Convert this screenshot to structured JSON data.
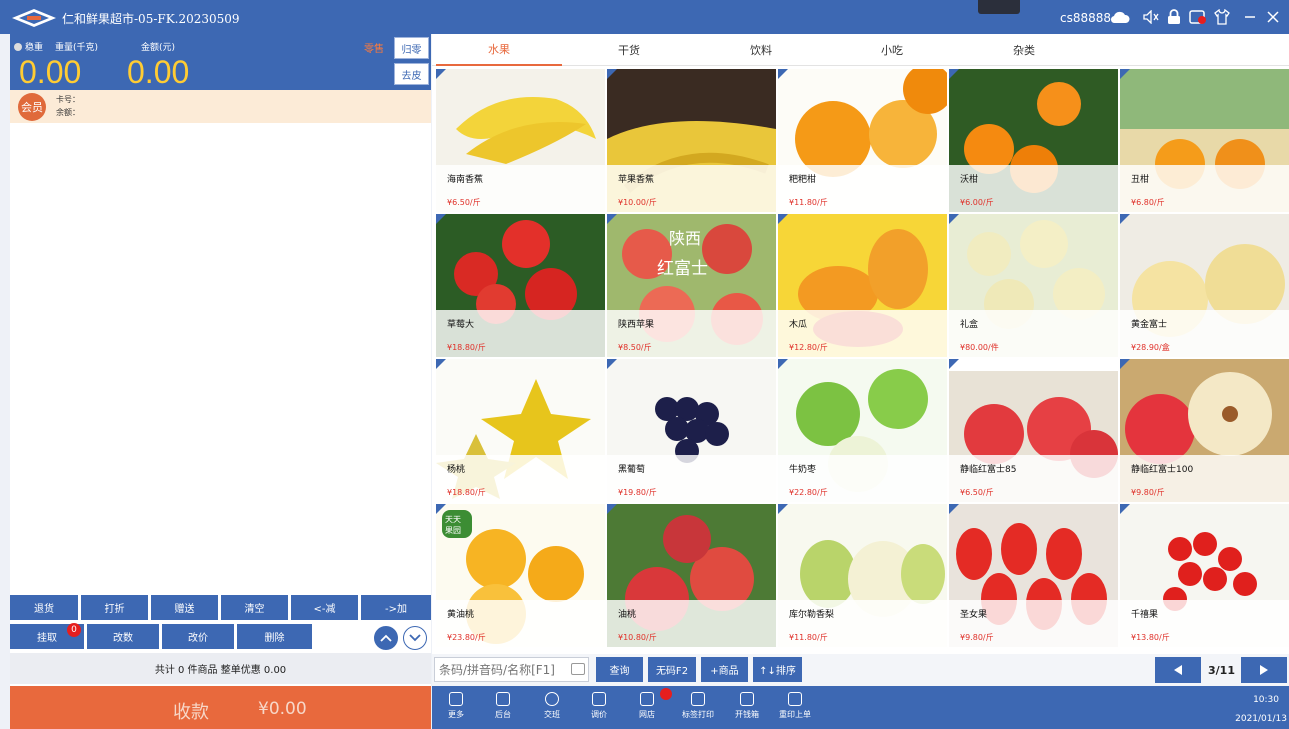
{
  "title_bar": {
    "app_title": "仁和鲜果超市-05-FK.20230509",
    "username": "cs88888",
    "icons": [
      "cloud-icon",
      "volume-icon",
      "lock-icon",
      "settings-icon",
      "shirt-icon",
      "minimize-icon",
      "close-icon"
    ]
  },
  "scale": {
    "stable_label": "稳重",
    "weight_label": "重量(千克)",
    "amount_label": "金额(元)",
    "weight_value": "0.00",
    "amount_value": "0.00",
    "sale_mode": "零售",
    "zero_button": "归零",
    "tare_button": "去皮"
  },
  "member": {
    "badge": "会员",
    "card_label": "卡号：",
    "balance_label": "余额："
  },
  "actions": {
    "row1": [
      "退货",
      "打折",
      "赠送",
      "清空",
      "<-减",
      "->加"
    ],
    "row2": [
      "挂取",
      "改数",
      "改价",
      "删除"
    ],
    "pending_count": "0"
  },
  "summary": "共计 0 件商品 整单优惠 0.00",
  "pay": {
    "label": "收款",
    "amount": "¥0.00"
  },
  "tabs": [
    "水果",
    "干货",
    "饮料",
    "小吃",
    "杂类"
  ],
  "active_tab": 0,
  "products": [
    {
      "name": "海南香蕉",
      "price": "¥6.50/斤"
    },
    {
      "name": "苹果香蕉",
      "price": "¥10.00/斤"
    },
    {
      "name": "粑粑柑",
      "price": "¥11.80/斤"
    },
    {
      "name": "沃柑",
      "price": "¥6.00/斤"
    },
    {
      "name": "丑柑",
      "price": "¥6.80/斤"
    },
    {
      "name": "草莓大",
      "price": "¥18.80/斤"
    },
    {
      "name": "陕西苹果",
      "price": "¥8.50/斤"
    },
    {
      "name": "木瓜",
      "price": "¥12.80/斤"
    },
    {
      "name": "礼盒",
      "price": "¥80.00/件"
    },
    {
      "name": "黄金富士",
      "price": "¥28.90/盒"
    },
    {
      "name": "杨桃",
      "price": "¥18.80/斤"
    },
    {
      "name": "黑葡萄",
      "price": "¥19.80/斤"
    },
    {
      "name": "牛奶枣",
      "price": "¥22.80/斤"
    },
    {
      "name": "静临红富士85",
      "price": "¥6.50/斤"
    },
    {
      "name": "静临红富士100",
      "price": "¥9.80/斤"
    },
    {
      "name": "黄油桃",
      "price": "¥23.80/斤"
    },
    {
      "name": "油桃",
      "price": "¥10.80/斤"
    },
    {
      "name": "库尔勒香梨",
      "price": "¥11.80/斤"
    },
    {
      "name": "圣女果",
      "price": "¥9.80/斤"
    },
    {
      "name": "千禧果",
      "price": "¥13.80/斤"
    }
  ],
  "product_image_texts": {
    "apple_overlay_top": "陕西",
    "apple_overlay_bottom": "红富士",
    "peach_logo": "天天果园"
  },
  "search": {
    "placeholder": "条码/拼音码/名称[F1]",
    "query_button": "查询",
    "no_code_button": "无码F2",
    "add_product_button": "+商品",
    "sort_button": "↑↓排序"
  },
  "pagination": {
    "indicator": "3/11"
  },
  "bottom_menu": [
    "更多",
    "后台",
    "交班",
    "调价",
    "网店",
    "标签打印",
    "开钱箱",
    "重印上单"
  ],
  "clock": {
    "time": "10:30",
    "date": "2021/01/13"
  },
  "colors": {
    "primary": "#3d68b3",
    "accent": "#e8693d",
    "price": "#e0322b",
    "amount_yellow": "#ffcc33"
  }
}
